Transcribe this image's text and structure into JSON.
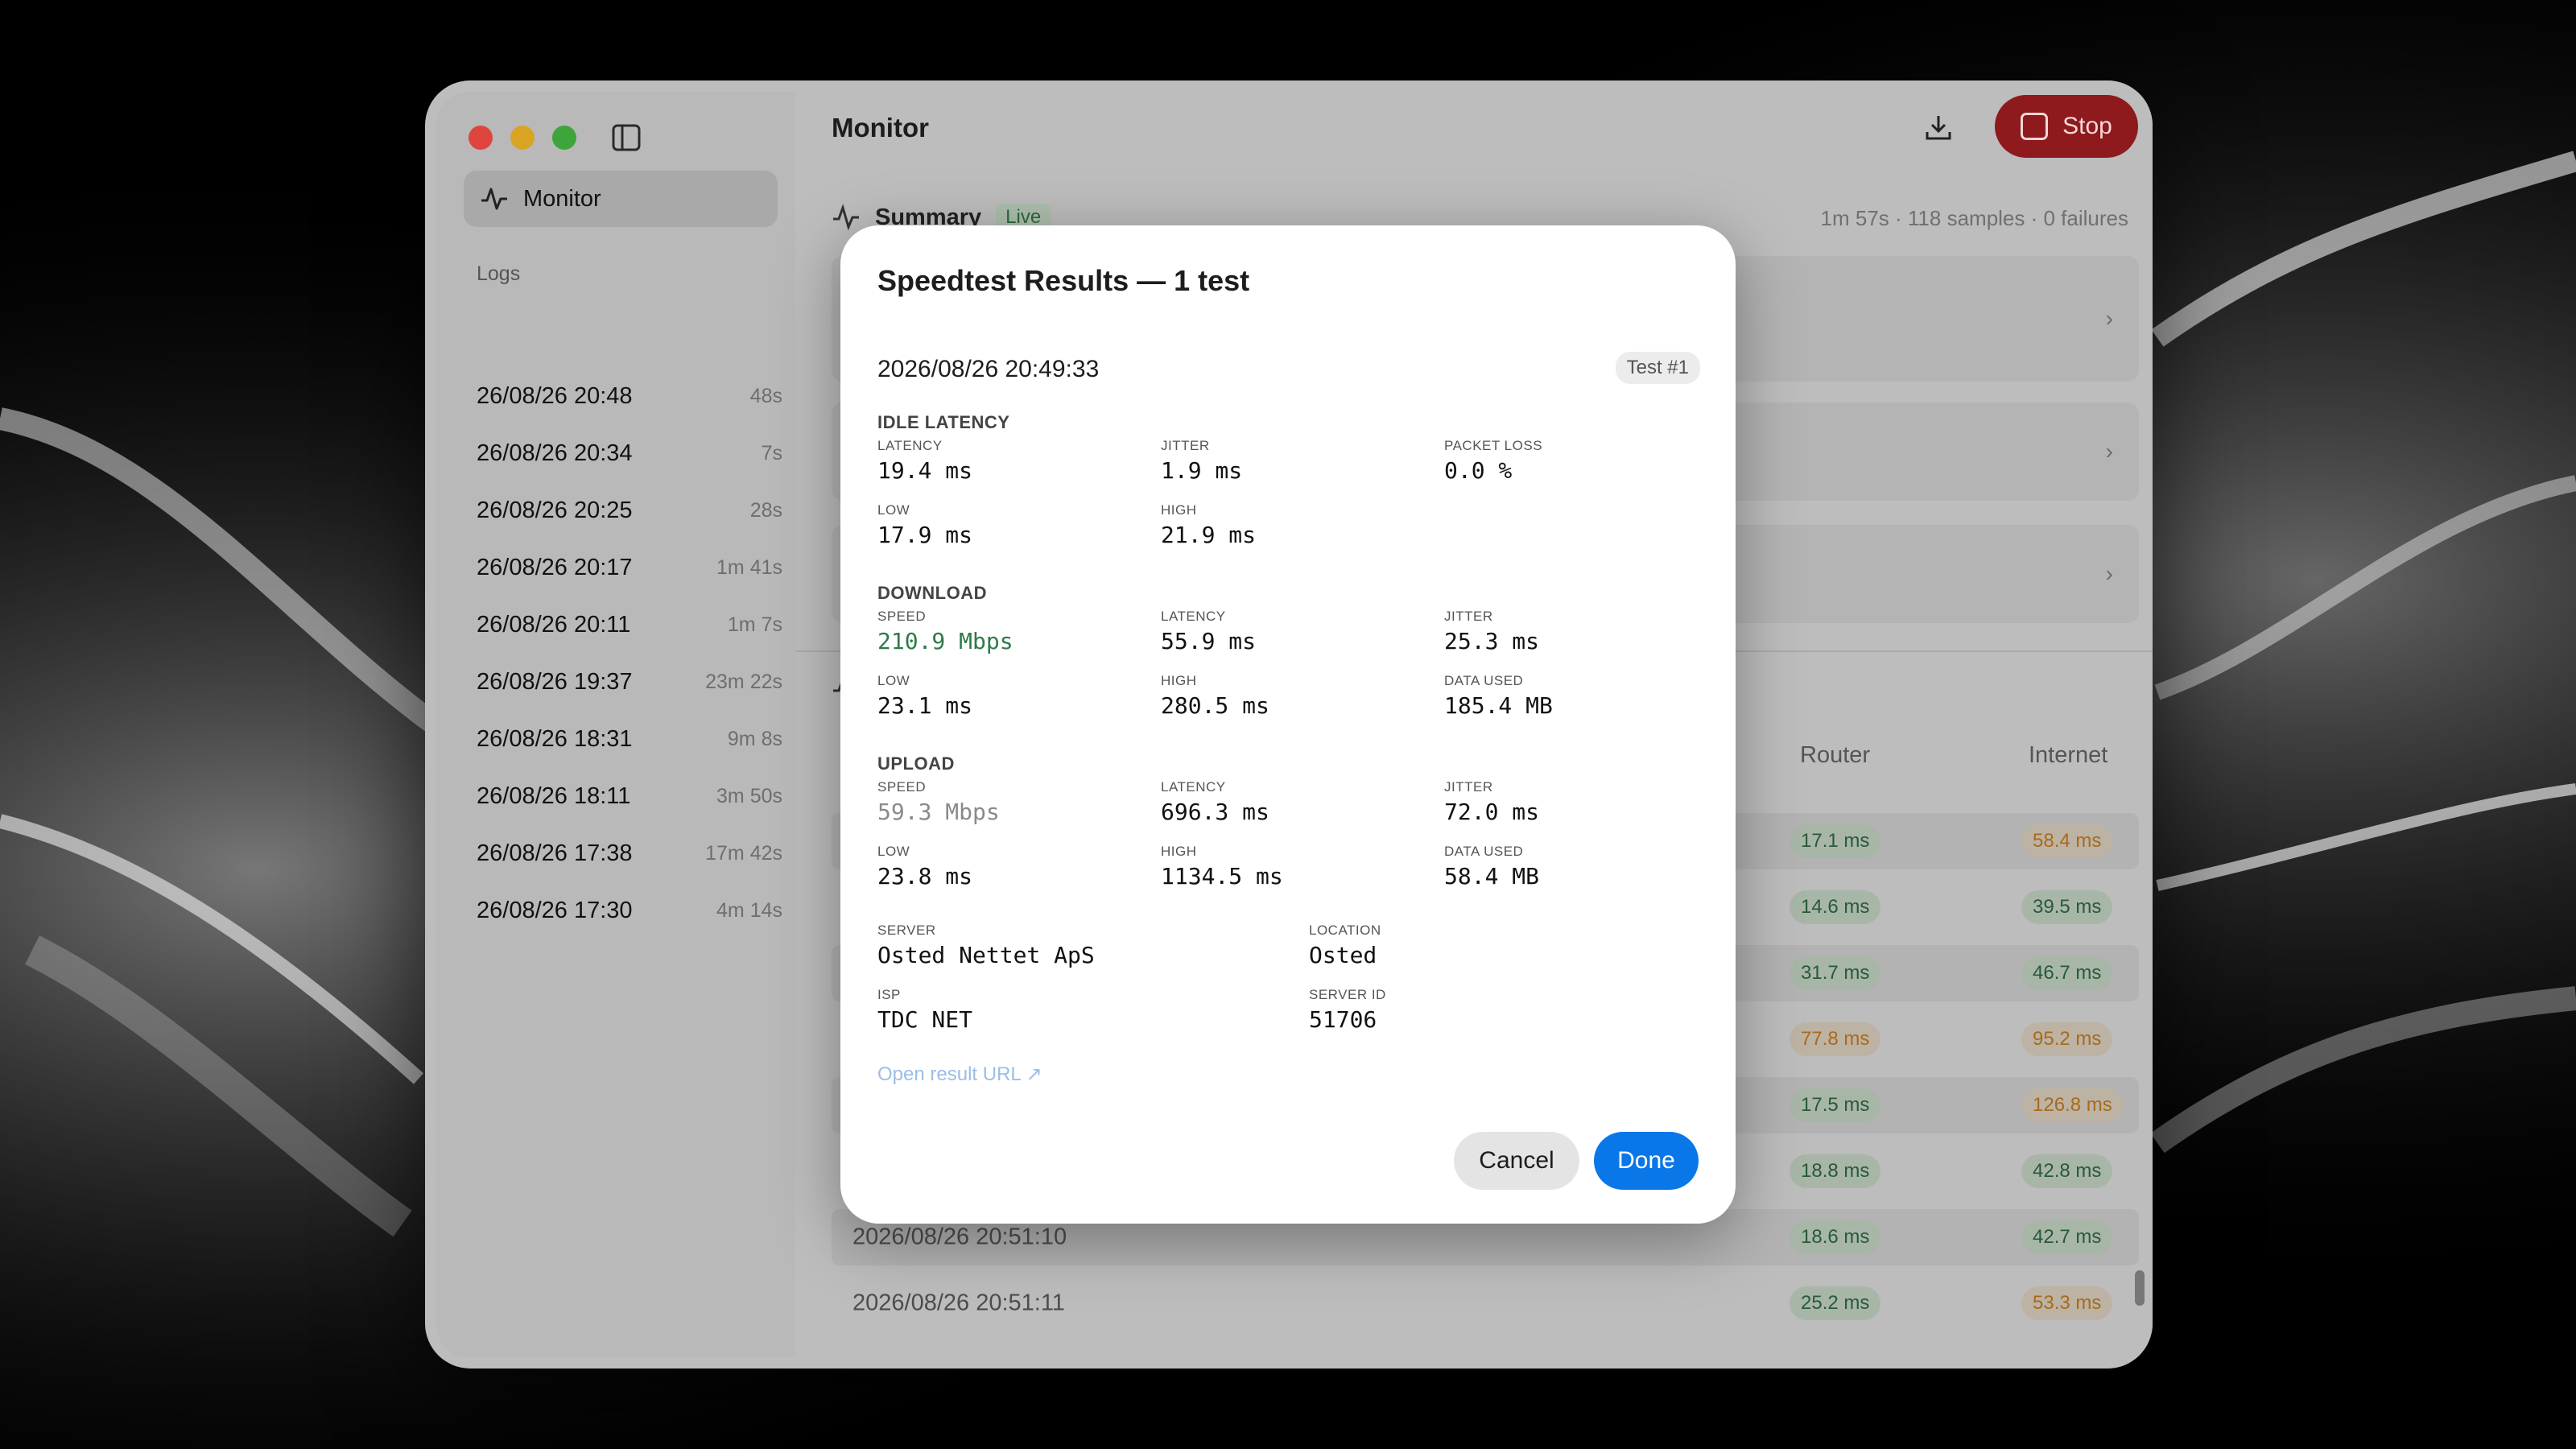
{
  "window": {
    "title": "Monitor"
  },
  "sidebar": {
    "nav_label": "Monitor",
    "logs_title": "Logs",
    "logs": [
      {
        "date": "26/08/26 20:48",
        "dur": "48s"
      },
      {
        "date": "26/08/26 20:34",
        "dur": "7s"
      },
      {
        "date": "26/08/26 20:25",
        "dur": "28s"
      },
      {
        "date": "26/08/26 20:17",
        "dur": "1m 41s"
      },
      {
        "date": "26/08/26 20:11",
        "dur": "1m 7s"
      },
      {
        "date": "26/08/26 19:37",
        "dur": "23m 22s"
      },
      {
        "date": "26/08/26 18:31",
        "dur": "9m 8s"
      },
      {
        "date": "26/08/26 18:11",
        "dur": "3m 50s"
      },
      {
        "date": "26/08/26 17:38",
        "dur": "17m 42s"
      },
      {
        "date": "26/08/26 17:30",
        "dur": "4m 14s"
      }
    ]
  },
  "toolbar": {
    "stop_label": "Stop"
  },
  "summary": {
    "title": "Summary",
    "badge": "Live",
    "stats": "1m 57s · 118 samples · 0 failures"
  },
  "table": {
    "headers": {
      "router": "Router",
      "internet": "Internet"
    },
    "rows": [
      {
        "time": "",
        "router": "17.1 ms",
        "router_status": "ok",
        "internet": "58.4 ms",
        "internet_status": "warn"
      },
      {
        "time": "",
        "router": "14.6 ms",
        "router_status": "ok",
        "internet": "39.5 ms",
        "internet_status": "ok"
      },
      {
        "time": "",
        "router": "31.7 ms",
        "router_status": "ok",
        "internet": "46.7 ms",
        "internet_status": "ok"
      },
      {
        "time": "",
        "router": "77.8 ms",
        "router_status": "warn",
        "internet": "95.2 ms",
        "internet_status": "warn"
      },
      {
        "time": "",
        "router": "17.5 ms",
        "router_status": "ok",
        "internet": "126.8 ms",
        "internet_status": "warn"
      },
      {
        "time": "",
        "router": "18.8 ms",
        "router_status": "ok",
        "internet": "42.8 ms",
        "internet_status": "ok"
      },
      {
        "time": "2026/08/26 20:51:10",
        "router": "18.6 ms",
        "router_status": "ok",
        "internet": "42.7 ms",
        "internet_status": "ok"
      },
      {
        "time": "2026/08/26 20:51:11",
        "router": "25.2 ms",
        "router_status": "ok",
        "internet": "53.3 ms",
        "internet_status": "warn"
      }
    ]
  },
  "dialog": {
    "title": "Speedtest Results — 1 test",
    "date": "2026/08/26 20:49:33",
    "test_badge": "Test #1",
    "idle": {
      "title": "IDLE LATENCY",
      "latency_label": "LATENCY",
      "latency": "19.4 ms",
      "jitter_label": "JITTER",
      "jitter": "1.9 ms",
      "loss_label": "PACKET LOSS",
      "loss": "0.0 %",
      "low_label": "LOW",
      "low": "17.9 ms",
      "high_label": "HIGH",
      "high": "21.9 ms"
    },
    "download": {
      "title": "DOWNLOAD",
      "speed_label": "SPEED",
      "speed": "210.9 Mbps",
      "latency_label": "LATENCY",
      "latency": "55.9 ms",
      "jitter_label": "JITTER",
      "jitter": "25.3 ms",
      "low_label": "LOW",
      "low": "23.1 ms",
      "high_label": "HIGH",
      "high": "280.5 ms",
      "data_label": "DATA USED",
      "data": "185.4 MB"
    },
    "upload": {
      "title": "UPLOAD",
      "speed_label": "SPEED",
      "speed": "59.3 Mbps",
      "latency_label": "LATENCY",
      "latency": "696.3 ms",
      "jitter_label": "JITTER",
      "jitter": "72.0 ms",
      "low_label": "LOW",
      "low": "23.8 ms",
      "high_label": "HIGH",
      "high": "1134.5 ms",
      "data_label": "DATA USED",
      "data": "58.4 MB"
    },
    "server": {
      "server_label": "SERVER",
      "server": "Osted Nettet ApS",
      "location_label": "LOCATION",
      "location": "Osted",
      "isp_label": "ISP",
      "isp": "TDC NET",
      "id_label": "SERVER ID",
      "id": "51706"
    },
    "link": "Open result URL ↗",
    "cancel": "Cancel",
    "done": "Done"
  },
  "colors": {
    "accent": "#0a77e8",
    "stop": "#8e1a1d",
    "ok": "#285a36",
    "warn": "#a86a1c"
  }
}
